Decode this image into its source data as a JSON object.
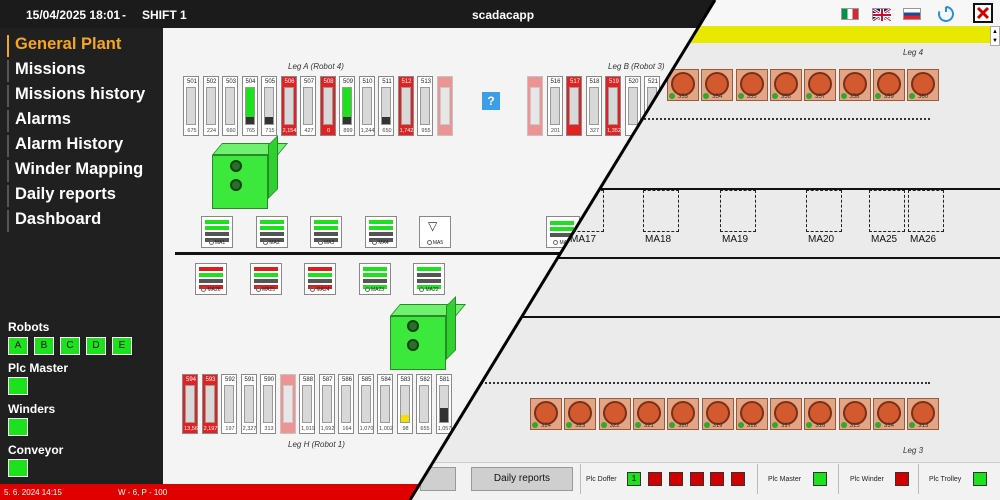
{
  "header": {
    "datetime": "15/04/2025 18:01",
    "separator": "-",
    "shift": "SHIFT 1",
    "app_title": "scadacapp"
  },
  "sidebar": {
    "menu": [
      {
        "label": "General Plant",
        "active": true
      },
      {
        "label": "Missions"
      },
      {
        "label": "Missions history"
      },
      {
        "label": "Alarms"
      },
      {
        "label": "Alarm History"
      },
      {
        "label": "Winder Mapping"
      },
      {
        "label": "Daily reports"
      },
      {
        "label": "Dashboard"
      }
    ],
    "robots_label": "Robots",
    "robots": [
      "A",
      "B",
      "C",
      "D",
      "E"
    ],
    "plc_master_label": "Plc Master",
    "winders_label": "Winders",
    "conveyor_label": "Conveyor",
    "status_color": "#1ee11e"
  },
  "status_bar": {
    "left": "5. 6. 2024 14:15",
    "right": "W - 6, P - 100"
  },
  "plant": {
    "lane_a_label": "Leg A (Robot 4)",
    "lane_b_label": "Leg B (Robot 3)",
    "lane_h_label": "Leg H (Robot 1)",
    "help_label": "?",
    "row_a": [
      {
        "n": "501",
        "v": "675",
        "s": "n",
        "f": 0
      },
      {
        "n": "502",
        "v": "224",
        "s": "n",
        "f": 0
      },
      {
        "n": "503",
        "v": "660",
        "s": "n",
        "f": 0
      },
      {
        "n": "504",
        "v": "765",
        "s": "g",
        "f": 0.8
      },
      {
        "n": "505",
        "v": "715",
        "s": "n",
        "f": 0.2
      },
      {
        "n": "506",
        "v": "2,154",
        "s": "r",
        "f": 0
      },
      {
        "n": "507",
        "v": "427",
        "s": "n",
        "f": 0
      },
      {
        "n": "508",
        "v": "0",
        "s": "r",
        "f": 0
      },
      {
        "n": "509",
        "v": "899",
        "s": "g",
        "f": 0.8
      },
      {
        "n": "510",
        "v": "1,244",
        "s": "n",
        "f": 0
      },
      {
        "n": "511",
        "v": "650",
        "s": "n",
        "f": 0.2
      },
      {
        "n": "512",
        "v": "1,742",
        "s": "r",
        "f": 0
      },
      {
        "n": "513",
        "v": "955",
        "s": "n",
        "f": 0
      },
      {
        "n": "",
        "v": "",
        "s": "f",
        "f": 0
      }
    ],
    "row_b": [
      {
        "n": "",
        "v": "",
        "s": "f",
        "f": 0
      },
      {
        "n": "516",
        "v": "201",
        "s": "n",
        "f": 0
      },
      {
        "n": "517",
        "v": "",
        "s": "r",
        "f": 0
      },
      {
        "n": "518",
        "v": "327",
        "s": "n",
        "f": 0
      },
      {
        "n": "519",
        "v": "1,352",
        "s": "r",
        "f": 0
      },
      {
        "n": "520",
        "v": "",
        "s": "n",
        "f": 0
      },
      {
        "n": "521",
        "v": "",
        "s": "n",
        "f": 0
      }
    ],
    "row_h": [
      {
        "n": "594",
        "v": "13,56",
        "s": "r",
        "f": 0
      },
      {
        "n": "593",
        "v": "2,197",
        "s": "r",
        "f": 0
      },
      {
        "n": "592",
        "v": "197",
        "s": "n",
        "f": 0
      },
      {
        "n": "591",
        "v": "2,327",
        "s": "n",
        "f": 0
      },
      {
        "n": "590",
        "v": "313",
        "s": "n",
        "f": 0
      },
      {
        "n": "",
        "v": "",
        "s": "f",
        "f": 0
      },
      {
        "n": "588",
        "v": "1,919",
        "s": "n",
        "f": 0
      },
      {
        "n": "587",
        "v": "1,692",
        "s": "n",
        "f": 0
      },
      {
        "n": "586",
        "v": "164",
        "s": "n",
        "f": 0
      },
      {
        "n": "585",
        "v": "1,070",
        "s": "n",
        "f": 0
      },
      {
        "n": "584",
        "v": "1,002",
        "s": "n",
        "f": 0
      },
      {
        "n": "583",
        "v": "98",
        "s": "n",
        "f": 0.2,
        "fc": "#f0e000"
      },
      {
        "n": "582",
        "v": "655",
        "s": "n",
        "f": 0
      },
      {
        "n": "581",
        "v": "1,057",
        "s": "n",
        "f": 0.4
      }
    ],
    "ma_upper": [
      "MA1",
      "MA2",
      "MA3",
      "MA4",
      "MA5"
    ],
    "ma_lower": [
      "MA26",
      "MA25",
      "MA24",
      "MA23",
      "MA22"
    ],
    "ma17_partial": "MA17",
    "colors": {
      "bin_fill": "#1ee11e",
      "bin_dark": "#333333",
      "alarm_red": "#e42020",
      "cube_green": "#3ce83c"
    }
  },
  "paneB": {
    "leg4_label": "Leg 4",
    "leg3_label": "Leg 3",
    "reels_top": [
      "353",
      "354",
      "355",
      "356",
      "357",
      "358",
      "359",
      "360"
    ],
    "reels_bottom": [
      "324",
      "323",
      "322",
      "321",
      "320",
      "319",
      "318",
      "317",
      "316",
      "315",
      "314",
      "313"
    ],
    "slots_row1": [
      {
        "label": "MA17"
      },
      {
        "label": "MA18"
      },
      {
        "label": "MA19"
      },
      {
        "label": "MA20"
      },
      {
        "label": "MA25"
      },
      {
        "label": "MA26"
      }
    ],
    "slots_row2": [
      {
        "label": "MA5"
      },
      {
        "label": "MA4"
      },
      {
        "label": "MA3"
      },
      {
        "label": "MA2"
      },
      {
        "label": "MA1"
      }
    ],
    "daily_reports_label": "Daily reports",
    "plc": {
      "doffer_label": "Plc Doffer",
      "doffer_first": "1",
      "master_label": "Plc Master",
      "winder_label": "Plc Winder",
      "trolley_label": "Plc Trolley"
    },
    "languages": [
      "Italiano",
      "English",
      "Slovenčina"
    ],
    "reel_color": "#d35a2f",
    "yellow_bar_color": "#e8e800"
  }
}
